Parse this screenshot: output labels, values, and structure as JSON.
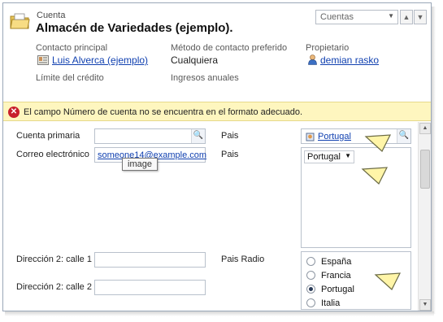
{
  "header": {
    "entity_label": "Cuenta",
    "title": "Almacén de Variedades (ejemplo).",
    "view_select": "Cuentas",
    "fields": {
      "primary_contact_label": "Contacto principal",
      "primary_contact_value": "Luis Alverca (ejemplo)",
      "contact_method_label": "Método de contacto preferido",
      "contact_method_value": "Cualquiera",
      "owner_label": "Propietario",
      "owner_value": "demian rasko",
      "credit_limit_label": "Límite del crédito",
      "annual_revenue_label": "Ingresos anuales"
    }
  },
  "alert": {
    "icon": "error-x-icon",
    "message": "El campo Número de cuenta no se encuentra en el formato adecuado."
  },
  "form": {
    "primary_account_label": "Cuenta primaria",
    "pais_label_1": "Pais",
    "pais_lookup_value": "Portugal",
    "email_label": "Correo electrónico",
    "email_value": "someone14@example.com",
    "tooltip": "image",
    "pais_label_2": "Pais",
    "pais_dropdown_value": "Portugal",
    "address2_line1_label": "Dirección 2: calle 1",
    "pais_radio_label": "Pais Radio",
    "address2_line2_label": "Dirección 2: calle 2",
    "radio_options": [
      {
        "label": "España",
        "selected": false
      },
      {
        "label": "Francia",
        "selected": false
      },
      {
        "label": "Portugal",
        "selected": true
      },
      {
        "label": "Italia",
        "selected": false
      }
    ]
  },
  "colors": {
    "alert_bg": "#fef6bf",
    "error_red": "#c8202c",
    "link_blue": "#1040b0",
    "pointer_yellow": "#fff5a8"
  }
}
